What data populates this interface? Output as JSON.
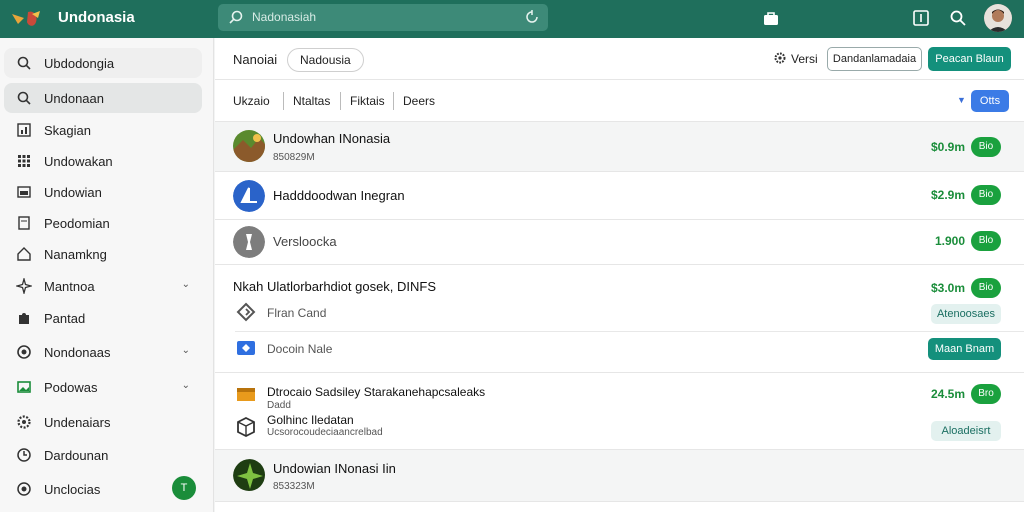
{
  "app": {
    "title": "Undonasia"
  },
  "search": {
    "placeholder": "Nadonasiah"
  },
  "sidebar": {
    "items": [
      {
        "label": "Ubdodongia",
        "icon": "search-icon"
      },
      {
        "label": "Undonaan",
        "icon": "search-icon"
      },
      {
        "label": "Skagian",
        "icon": "chart-icon"
      },
      {
        "label": "Undowakan",
        "icon": "grid-icon"
      },
      {
        "label": "Undowian",
        "icon": "image-icon"
      },
      {
        "label": "Peodomian",
        "icon": "document-icon"
      },
      {
        "label": "Nanamkng",
        "icon": "home-icon"
      },
      {
        "label": "Mantnoa",
        "icon": "sparkle-icon",
        "chevron": "⌄"
      },
      {
        "label": "Pantad",
        "icon": "puzzle-icon"
      },
      {
        "label": "Nondonaas",
        "icon": "circle-icon",
        "chevron": "⌄"
      },
      {
        "label": "Podowas",
        "icon": "photo-icon",
        "chevron": "⌄"
      },
      {
        "label": "Undenaiars",
        "icon": "gear-icon"
      },
      {
        "label": "Dardounan",
        "icon": "clock-icon"
      },
      {
        "label": "Unclocias",
        "icon": "globe-icon",
        "badge": "T"
      }
    ]
  },
  "header": {
    "title": "Nanoiai",
    "chip": "Nadousia",
    "versi": "Versi",
    "outline_btn": "Dandanlamadaia",
    "teal_btn": "Peacan Blaun"
  },
  "tabs": {
    "items": [
      "Ukzaio",
      "Ntaltas",
      "Fiktais",
      "Deers"
    ],
    "action_btn": "Otts"
  },
  "list": {
    "rows": [
      {
        "title": "Undowhan INonasia",
        "sub": "850829M",
        "price": "$0.9m",
        "pill": "Bio"
      },
      {
        "title": "Hadddoodwan Inegran",
        "price": "$2.9m",
        "pill": "Bio"
      },
      {
        "title": "Versloocka",
        "price": "1.900",
        "pill": "Blo"
      },
      {
        "title": "Nkah Ulatlorbarhdiot gosek, DINFS",
        "price": "$3.0m",
        "pill": "Bio",
        "sub_items": [
          {
            "label": "Flran Cand",
            "button": "Atenoosaes"
          },
          {
            "label": "Docoin Nale",
            "button": "Maan Bnam"
          }
        ]
      },
      {
        "title": "Dtrocaio Sadsiley Starakanehapcsaleaks",
        "title_sub": "Dadd",
        "price": "24.5m",
        "pill": "Bro",
        "second_title": "Golhinc Iledatan",
        "second_sub": "Ucsorocoudeciaancrelbad",
        "button": "Aloadeisrt"
      },
      {
        "title": "Undowian INonasi Iin",
        "sub": "853323M"
      }
    ]
  },
  "colors": {
    "topbar": "#1f6f5c",
    "accent_teal": "#14907c",
    "accent_green": "#1aa13e",
    "accent_blue": "#3b7be6"
  }
}
